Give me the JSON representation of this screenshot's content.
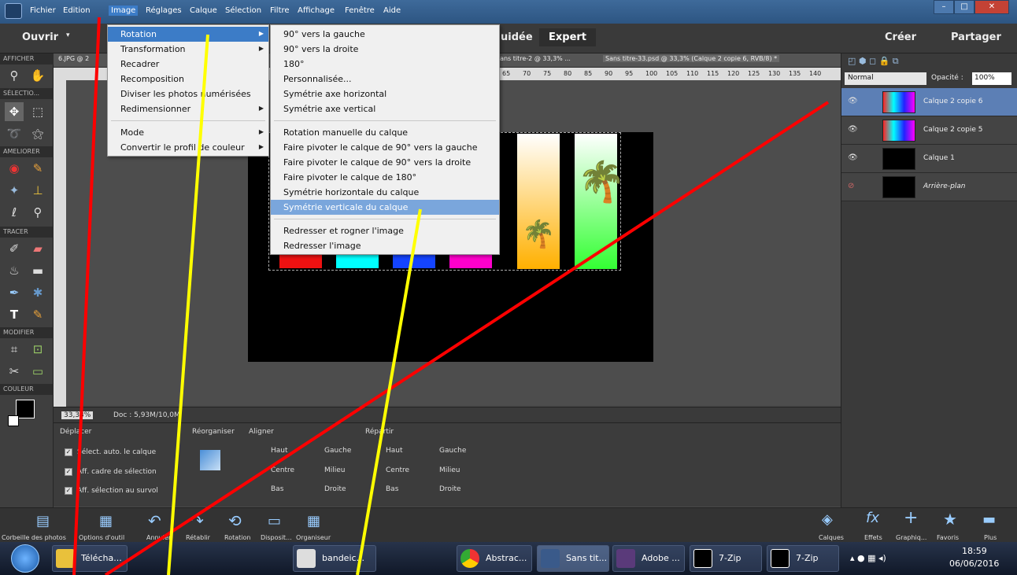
{
  "menubar": [
    "Fichier",
    "Edition",
    "Image",
    "Réglages",
    "Calque",
    "Sélection",
    "Filtre",
    "Affichage",
    "Fenêtre",
    "Aide"
  ],
  "window_buttons": [
    "–",
    "□",
    "✕"
  ],
  "topbar": {
    "open": "Ouvrir",
    "mode_guided": "uidée",
    "mode_expert": "Expert",
    "create": "Créer",
    "share": "Partager"
  },
  "tabs": [
    "6.JPG @ 2",
    "Sans titre-2 @ 33,3% ...",
    "Sans titre-33.psd @ 33,3% (Calque 2 copie 6, RVB/8) *"
  ],
  "ruler_marks": [
    "65",
    "70",
    "75",
    "80",
    "85",
    "90",
    "95",
    "100",
    "105",
    "110",
    "115",
    "120",
    "125",
    "130",
    "135",
    "140"
  ],
  "left_sections": [
    "AFFICHER",
    "SÉLECTIO...",
    "AMELIORER",
    "TRACER",
    "MODIFIER",
    "COULEUR"
  ],
  "image_menu": {
    "items": [
      "Rotation",
      "Transformation",
      "Recadrer",
      "Recomposition",
      "Diviser les photos numérisées",
      "Redimensionner",
      "Mode",
      "Convertir le profil de couleur"
    ]
  },
  "rotation_menu": {
    "items": [
      "90° vers la gauche",
      "90° vers la droite",
      "180°",
      "Personnalisée...",
      "Symétrie axe horizontal",
      "Symétrie axe vertical",
      "Rotation manuelle du calque",
      "Faire pivoter le calque de 90° vers la gauche",
      "Faire pivoter le calque de 90° vers la droite",
      "Faire pivoter le calque de 180°",
      "Symétrie horizontale du calque",
      "Symétrie verticale du calque",
      "Redresser et rogner l'image",
      "Redresser l'image"
    ]
  },
  "layers_panel": {
    "blend_mode": "Normal",
    "opacity_label": "Opacité :",
    "opacity_value": "100%",
    "layers": [
      {
        "name": "Calque 2 copie 6",
        "selected": true
      },
      {
        "name": "Calque 2 copie 5",
        "selected": false
      },
      {
        "name": "Calque 1",
        "selected": false
      },
      {
        "name": "Arrière-plan",
        "selected": false
      }
    ]
  },
  "status": {
    "zoom": "33,33%",
    "doc": "Doc : 5,93M/10,0M"
  },
  "options": {
    "move_title": "Déplacer",
    "checks": [
      "Sélect. auto. le calque",
      "Aff. cadre de sélection",
      "Aff. sélection au survol"
    ],
    "arrange": "Réorganiser",
    "align": "Aligner",
    "distribute": "Répartir",
    "align_items": [
      "Haut",
      "Gauche",
      "Centre",
      "Milieu",
      "Bas",
      "Droite"
    ],
    "dist_items": [
      "Haut",
      "Gauche",
      "Centre",
      "Milieu",
      "Bas",
      "Droite"
    ]
  },
  "bottombar": {
    "left": [
      "Corbeille des photos",
      "Options d'outil",
      "Annuler",
      "Rétablir",
      "Rotation",
      "Disposit...",
      "Organiseur"
    ],
    "right": [
      "Calques",
      "Effets",
      "Graphiq...",
      "Favoris",
      "Plus"
    ]
  },
  "taskbar": {
    "tasks": [
      "Télécha...",
      "bandeic...",
      "Abstrac...",
      "Sans tit...",
      "Adobe ...",
      "7-Zip",
      "7-Zip"
    ],
    "time": "18:59",
    "date": "06/06/2016"
  },
  "colors": {
    "accent": "#3c7cc7",
    "annot_red": "#ff0000",
    "annot_yellow": "#ffff00"
  }
}
